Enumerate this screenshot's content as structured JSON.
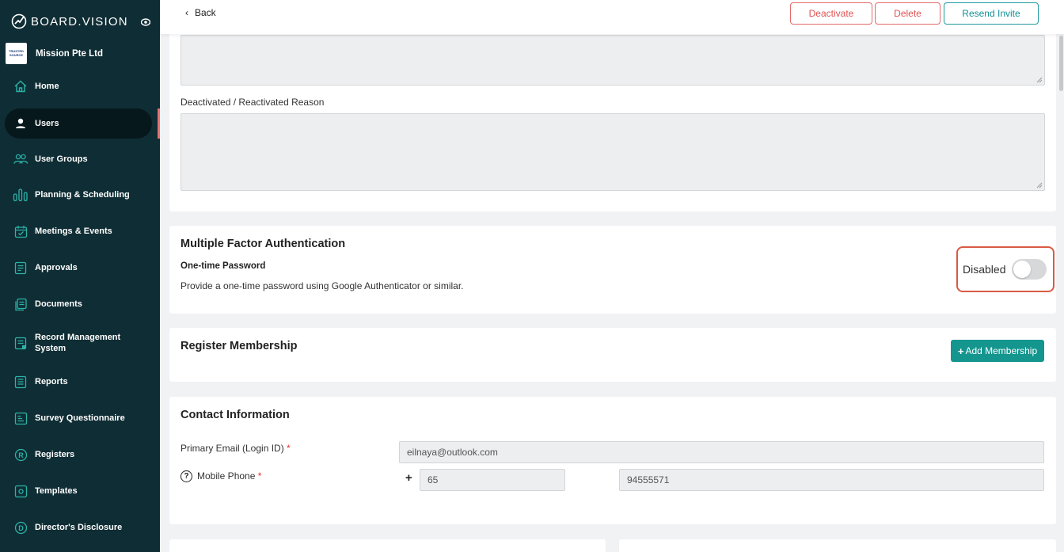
{
  "brand": {
    "name": "BOARD.VISION"
  },
  "org": {
    "name": "Mission Pte Ltd",
    "logo_line1": "TRUSTED",
    "logo_line2": "SOURCE"
  },
  "nav": [
    {
      "label": "Home",
      "icon": "home-icon"
    },
    {
      "label": "Users",
      "icon": "user-icon",
      "active": true
    },
    {
      "label": "User Groups",
      "icon": "user-group-icon"
    },
    {
      "label": "Planning & Scheduling",
      "icon": "planning-icon"
    },
    {
      "label": "Meetings & Events",
      "icon": "calendar-icon"
    },
    {
      "label": "Approvals",
      "icon": "approvals-icon"
    },
    {
      "label": "Documents",
      "icon": "documents-icon"
    },
    {
      "label": "Record Management System",
      "icon": "record-icon"
    },
    {
      "label": "Reports",
      "icon": "reports-icon"
    },
    {
      "label": "Survey Questionnaire",
      "icon": "survey-icon"
    },
    {
      "label": "Registers",
      "icon": "registers-icon"
    },
    {
      "label": "Templates",
      "icon": "templates-icon"
    },
    {
      "label": "Director's Disclosure",
      "icon": "disclosure-icon"
    }
  ],
  "topbar": {
    "back_label": "Back",
    "deactivate_label": "Deactivate",
    "delete_label": "Delete",
    "resend_label": "Resend Invite"
  },
  "reason": {
    "label": "Deactivated / Reactivated Reason",
    "value": ""
  },
  "mfa": {
    "title": "Multiple Factor Authentication",
    "subtitle": "One-time Password",
    "description": "Provide a one-time password using Google Authenticator or similar.",
    "status_label": "Disabled",
    "enabled": false
  },
  "membership": {
    "title": "Register Membership",
    "add_label": "Add Membership"
  },
  "contact": {
    "title": "Contact Information",
    "email_label": "Primary Email (Login ID)",
    "email_value": "eilnaya@outlook.com",
    "phone_label": "Mobile Phone",
    "country_code": "65",
    "phone_number": "94555571",
    "required_mark": "*",
    "plus": "+"
  },
  "colors": {
    "sidebar_bg": "#0f2d34",
    "accent": "#14968f",
    "danger": "#e05252",
    "highlight": "#d95a44"
  }
}
